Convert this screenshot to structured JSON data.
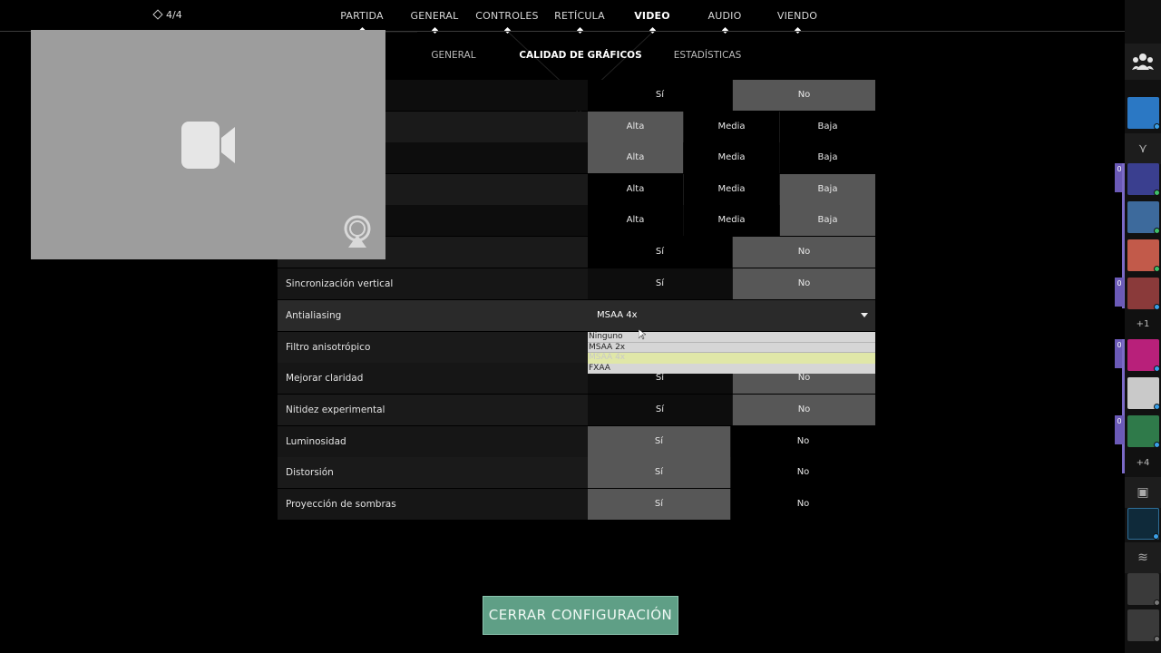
{
  "topnav": {
    "party_count": "4/4",
    "tabs": [
      {
        "label": "PARTIDA"
      },
      {
        "label": "GENERAL"
      },
      {
        "label": "CONTROLES"
      },
      {
        "label": "RETÍCULA"
      },
      {
        "label": "VIDEO"
      },
      {
        "label": "AUDIO"
      },
      {
        "label": "VIENDO"
      }
    ],
    "active_tab": "VIDEO"
  },
  "subtabs": [
    {
      "label": "GENERAL"
    },
    {
      "label": "CALIDAD DE GRÁFICOS"
    },
    {
      "label": "ESTADÍSTICAS"
    }
  ],
  "active_subtab": "CALIDAD DE GRÁFICOS",
  "settings": {
    "row1": {
      "label": "",
      "options": [
        "Sí",
        "No"
      ],
      "selected": "No"
    },
    "row2": {
      "label": "",
      "options": [
        "Alta",
        "Media",
        "Baja"
      ],
      "selected": "Alta"
    },
    "row3": {
      "label": "",
      "options": [
        "Alta",
        "Media",
        "Baja"
      ],
      "selected": "Alta"
    },
    "row4": {
      "label": "",
      "options": [
        "Alta",
        "Media",
        "Baja"
      ],
      "selected": "Baja"
    },
    "row5": {
      "label": "",
      "options": [
        "Alta",
        "Media",
        "Baja"
      ],
      "selected": "Baja"
    },
    "row6": {
      "label": "",
      "options": [
        "Sí",
        "No"
      ],
      "selected": "No"
    },
    "vsync": {
      "label": "Sincronización vertical",
      "options": [
        "Sí",
        "No"
      ],
      "selected": "No"
    },
    "antialiasing": {
      "label": "Antialiasing",
      "value": "MSAA 4x",
      "dropdown": [
        "Ninguno",
        "MSAA 2x",
        "MSAA 4x",
        "FXAA"
      ]
    },
    "aniso": {
      "label": "Filtro anisotrópico"
    },
    "clarity": {
      "label": "Mejorar claridad",
      "options": [
        "Sí",
        "No"
      ],
      "selected": "No"
    },
    "sharpness": {
      "label": "Nitidez experimental",
      "options": [
        "Sí",
        "No"
      ],
      "selected": "No"
    },
    "bloom": {
      "label": "Luminosidad",
      "options": [
        "Sí",
        "No"
      ],
      "selected": "Sí"
    },
    "distortion": {
      "label": "Distorsión",
      "options": [
        "Sí",
        "No"
      ],
      "selected": "Sí"
    },
    "shadows": {
      "label": "Proyección de sombras",
      "options": [
        "Sí",
        "No"
      ],
      "selected": "Sí"
    }
  },
  "close_button": "CERRAR CONFIGURACIÓN",
  "sidebar": {
    "party_badge": "0",
    "more_1": "+1",
    "more_2": "+4"
  },
  "colors": {
    "close_button": "#5f9f86",
    "selected_option": "#575757",
    "dropdown_current": "#e0e7a8",
    "party_accent": "#7b6ac7"
  }
}
